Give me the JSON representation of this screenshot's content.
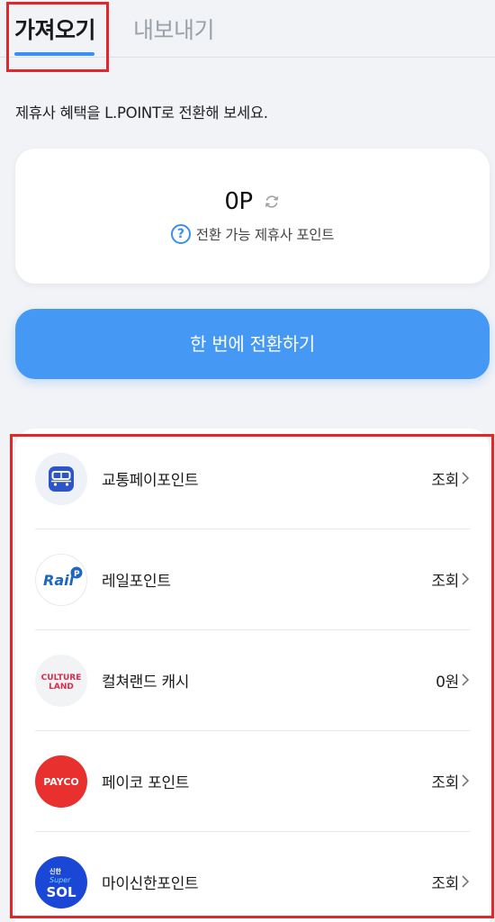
{
  "tabs": [
    {
      "label": "가져오기",
      "active": true
    },
    {
      "label": "내보내기",
      "active": false
    }
  ],
  "description": "제휴사 혜택을 L.POINT로 전환해 보세요.",
  "points": {
    "value": "0P",
    "help_label": "전환 가능 제휴사 포인트",
    "help_icon_glyph": "?"
  },
  "convert_button": "한 번에 전환하기",
  "partners": [
    {
      "name": "교통페이포인트",
      "value": "조회",
      "logo": "bus-icon"
    },
    {
      "name": "레일포인트",
      "value": "조회",
      "logo": "rail-logo",
      "logo_text": "Rail",
      "logo_badge": "P"
    },
    {
      "name": "컬쳐랜드 캐시",
      "value": "0원",
      "logo": "cultureland-logo",
      "logo_text_1": "CULTURE",
      "logo_text_2": "LAND"
    },
    {
      "name": "페이코 포인트",
      "value": "조회",
      "logo": "payco-logo",
      "logo_text": "PAYCO"
    },
    {
      "name": "마이신한포인트",
      "value": "조회",
      "logo": "shinhan-sol-logo",
      "logo_text_1": "신한",
      "logo_text_2": "Super",
      "logo_text_3": "SOL"
    }
  ],
  "colors": {
    "accent": "#4599f4",
    "highlight": "#e2262a",
    "payco": "#e8302f",
    "sol": "#1a47d6",
    "cultureland": "#e0294b",
    "rail": "#1d66c4"
  }
}
